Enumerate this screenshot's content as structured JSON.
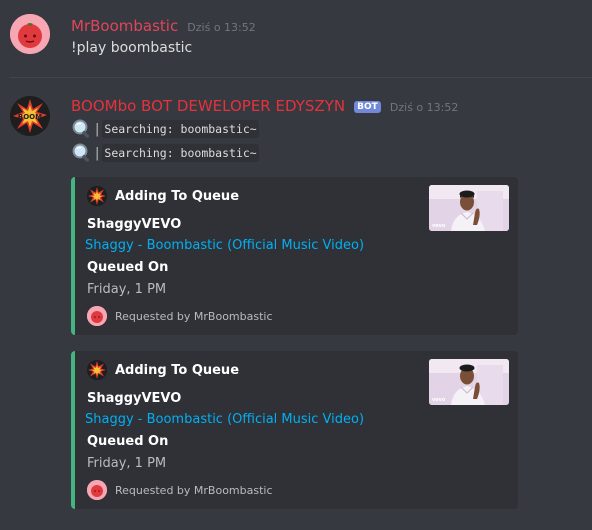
{
  "messages": [
    {
      "author": "MrBoombastic",
      "timestamp": "Dziś o 13:52",
      "content": "!play boombastic"
    },
    {
      "author": "BOOMbo BOT DEWELOPER EDYSZYN",
      "bot_tag": "BOT",
      "timestamp": "Dziś o 13:52",
      "search_lines": [
        {
          "separator": "|",
          "text": "Searching: boombastic~"
        },
        {
          "separator": "|",
          "text": "Searching: boombastic~"
        }
      ],
      "embeds": [
        {
          "author": "Adding To Queue",
          "title": "ShaggyVEVO",
          "description": "Shaggy - Boombastic (Official Music Video)",
          "field_name": "Queued On",
          "field_value": "Friday, 1 PM",
          "footer": "Requested by MrBoombastic"
        },
        {
          "author": "Adding To Queue",
          "title": "ShaggyVEVO",
          "description": "Shaggy - Boombastic (Official Music Video)",
          "field_name": "Queued On",
          "field_value": "Friday, 1 PM",
          "footer": "Requested by MrBoombastic"
        }
      ]
    }
  ],
  "icons": {
    "search": "magnifying-glass-icon",
    "boom": "boom-explosion-icon"
  },
  "colors": {
    "background": "#36393f",
    "user_name": "#e0455c",
    "bot_name": "#e5323d",
    "bot_tag": "#7289da",
    "embed_bar": "#43b581",
    "link": "#00b0f4",
    "embed_bg": "#2f3136"
  }
}
